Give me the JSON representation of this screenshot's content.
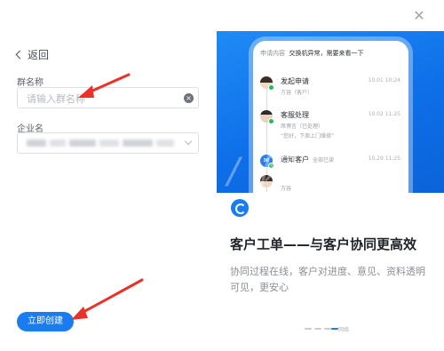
{
  "dialog": {
    "close_icon": "close-icon"
  },
  "form": {
    "back_label": "返回",
    "group_name_label": "群名称",
    "group_name_placeholder": "请输入群名称",
    "company_label": "企业名",
    "create_button": "立即创建"
  },
  "promo": {
    "phone_header_label": "申请内容",
    "phone_header_value": "交换机异常，需要来看一下",
    "timeline": [
      {
        "title": "发起申请",
        "sub": "方容（客户）",
        "time": "10.01  10:24"
      },
      {
        "title": "客服处理",
        "sub": "席博言（已处理）",
        "sub2": "“您好，下周上门维修”",
        "time": "10.02  11:25"
      },
      {
        "title": "通知客户",
        "tag": "全部已读",
        "sub": "方容",
        "time": "10.29  11:25"
      }
    ],
    "watermark": "/ 网",
    "title": "客户工单——与客户协同更高效",
    "desc": "协同过程在线，客户对进度、意见、资料透明可见，更安心",
    "dots_text": "网络"
  },
  "colors": {
    "accent": "#1b7cf0",
    "arrow": "#e8322b"
  }
}
